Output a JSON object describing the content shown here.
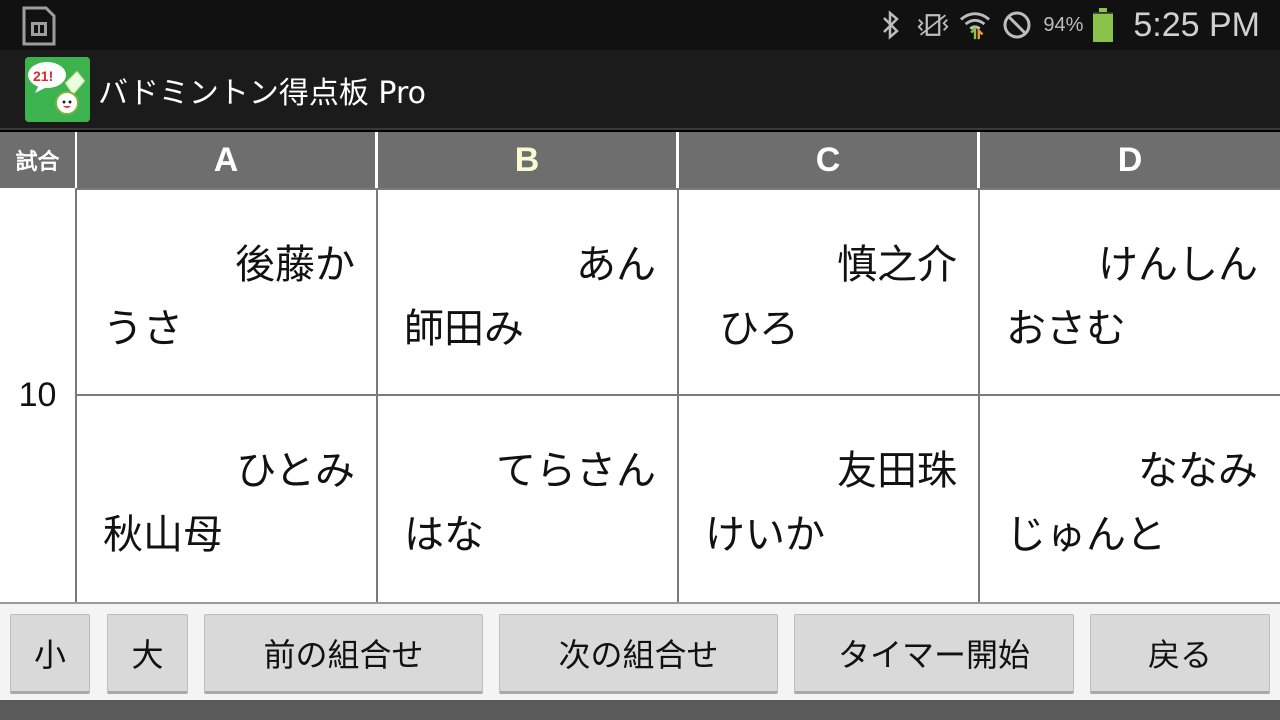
{
  "status_bar": {
    "battery_percent": "94%",
    "battery_level": 0.94,
    "time": "5:25 PM",
    "icons": [
      "sd-card-icon",
      "bluetooth-icon",
      "vibrate-icon",
      "wifi-icon",
      "do-not-disturb-icon",
      "battery-icon"
    ]
  },
  "app": {
    "title": "バドミントン得点板 Pro",
    "icon": "app-shuttlecock-icon",
    "icon_badge": "21!"
  },
  "board": {
    "match_header": "試合",
    "courts": [
      "A",
      "B",
      "C",
      "D"
    ],
    "selected_court": "B",
    "match_number": "10",
    "pairs": {
      "top": [
        {
          "l1": "後藤か",
          "l2": "うさ"
        },
        {
          "l1": "あん",
          "l2": "師田み"
        },
        {
          "l1": "慎之介",
          "l2": "ひろ"
        },
        {
          "l1": "けんしん",
          "l2": "おさむ"
        }
      ],
      "bottom": [
        {
          "l1": "ひとみ",
          "l2": "秋山母"
        },
        {
          "l1": "てらさん",
          "l2": "はな"
        },
        {
          "l1": "友田珠",
          "l2": "けいか"
        },
        {
          "l1": "ななみ",
          "l2": "じゅんと"
        }
      ]
    }
  },
  "buttons": {
    "small": "小",
    "large": "大",
    "prev": "前の組合せ",
    "next": "次の組合せ",
    "timer": "タイマー開始",
    "back": "戻る"
  },
  "colors": {
    "header_bg": "#6e6e6e",
    "selected_court_text": "#fafad2",
    "battery": "#8bc34a",
    "app_icon_bg": "#2aa84a"
  }
}
